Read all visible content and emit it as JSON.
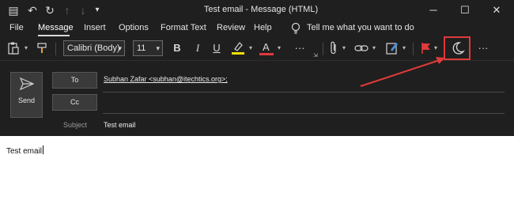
{
  "window": {
    "title": "Test email  -  Message (HTML)",
    "controls": {
      "minimize": "─",
      "maximize": "☐",
      "close": "✕"
    }
  },
  "quick_access": {
    "save": "▤",
    "undo": "↶",
    "redo": "↻",
    "up": "↑",
    "down": "↓",
    "customize": "▾"
  },
  "menu": {
    "items": [
      "File",
      "Message",
      "Insert",
      "Options",
      "Format Text",
      "Review",
      "Help"
    ],
    "tell_me_icon": "lightbulb-icon",
    "tell_me": "Tell me what you want to do"
  },
  "ribbon": {
    "font_name": "Calibri (Body)",
    "font_size": "11",
    "bold": "B",
    "italic": "I",
    "underline": "U",
    "font_color_letter": "A",
    "more": "···",
    "highlight_color": "#f0e000",
    "font_color": "#e03a3a",
    "flag_color": "#e03a3a",
    "accent_box_color": "#e03a3a",
    "overflow": "···"
  },
  "compose": {
    "send_label": "Send",
    "to_label": "To",
    "cc_label": "Cc",
    "to_value": "Subhan Zafar <subhan@itechtics.org>;",
    "cc_value": "",
    "subject_label": "Subject",
    "subject_value": "Test email"
  },
  "body": {
    "text": "Test email"
  }
}
